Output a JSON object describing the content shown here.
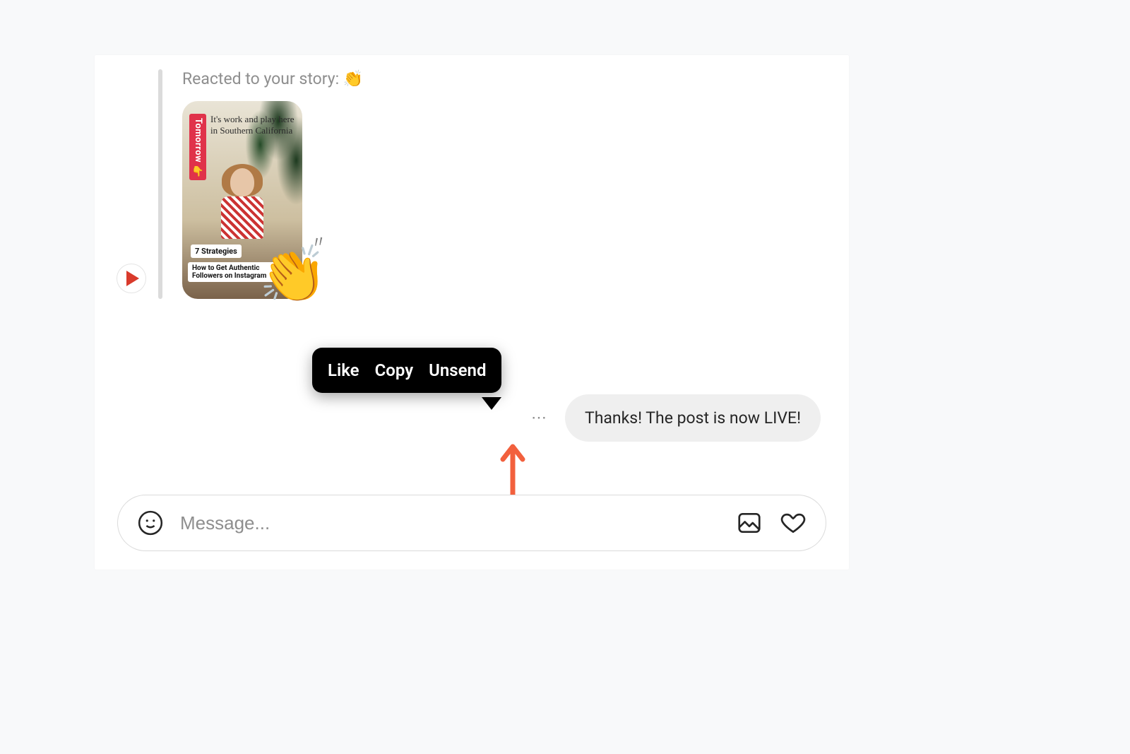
{
  "reaction": {
    "label_prefix": "Reacted to your story: ",
    "emoji": "👏"
  },
  "story": {
    "sidebar_text": "Tomorrow",
    "sidebar_emoji": "👇",
    "script_text": "It's work and play here in Southern California",
    "chip1": "7 Strategies",
    "chip2": "How to Get Authentic Followers on Instagram",
    "overlay_emoji": "👏"
  },
  "context_menu": {
    "like": "Like",
    "copy": "Copy",
    "unsend": "Unsend"
  },
  "outgoing": {
    "text": "Thanks! The post is now LIVE!"
  },
  "composer": {
    "placeholder": "Message..."
  }
}
